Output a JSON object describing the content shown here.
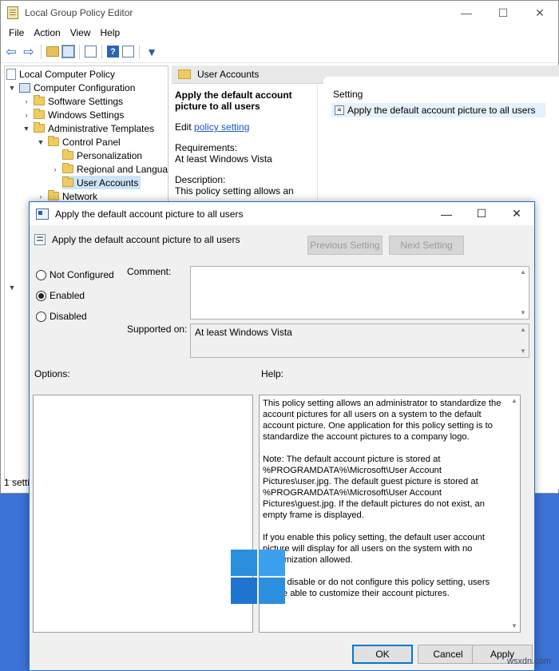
{
  "editor": {
    "title": "Local Group Policy Editor",
    "controls": {
      "minimize": "—",
      "maximize": "☐",
      "close": "✕"
    },
    "menu": [
      "File",
      "Action",
      "View",
      "Help"
    ],
    "tree": {
      "root": "Local Computer Policy",
      "computer_config": "Computer Configuration",
      "software_settings": "Software Settings",
      "windows_settings": "Windows Settings",
      "admin_templates": "Administrative Templates",
      "control_panel": "Control Panel",
      "personalization": "Personalization",
      "regional": "Regional and Languag",
      "user_accounts": "User Accounts",
      "network": "Network"
    },
    "status": "1 setti",
    "right_header": "User Accounts",
    "extended": {
      "title": "Apply the default account picture to all users",
      "edit_prefix": "Edit ",
      "edit_link": "policy setting",
      "requirements_label": "Requirements:",
      "requirements_value": "At least Windows Vista",
      "description_label": "Description:",
      "description_value": "This policy setting allows an"
    },
    "setting_column": "Setting",
    "setting_row": "Apply the default account picture to all users"
  },
  "dialog": {
    "title": "Apply the default account picture to all users",
    "controls": {
      "minimize": "—",
      "maximize": "☐",
      "close": "✕"
    },
    "subtitle": "Apply the default account picture to all users",
    "previous_setting": "Previous Setting",
    "next_setting": "Next Setting",
    "radio": {
      "not_configured": "Not Configured",
      "enabled": "Enabled",
      "disabled": "Disabled",
      "selected": "enabled"
    },
    "comment_label": "Comment:",
    "comment_value": "",
    "supported_label": "Supported on:",
    "supported_value": "At least Windows Vista",
    "options_label": "Options:",
    "help_label": "Help:",
    "help_paragraphs": [
      "This policy setting allows an administrator to standardize the account pictures for all users on a system to the default account picture. One application for this policy setting is to standardize the account pictures to a company logo.",
      "Note: The default account picture is stored at %PROGRAMDATA%\\Microsoft\\User Account Pictures\\user.jpg. The default guest picture is stored at %PROGRAMDATA%\\Microsoft\\User Account Pictures\\guest.jpg. If the default pictures do not exist, an empty frame is displayed.",
      "If you enable this policy setting, the default user account picture will display for all users on the system with no customization allowed.",
      "If you disable or do not configure this policy setting, users will be able to customize their account pictures."
    ],
    "ok": "OK",
    "cancel": "Cancel",
    "apply": "Apply"
  },
  "watermark": "wsxdn.com"
}
